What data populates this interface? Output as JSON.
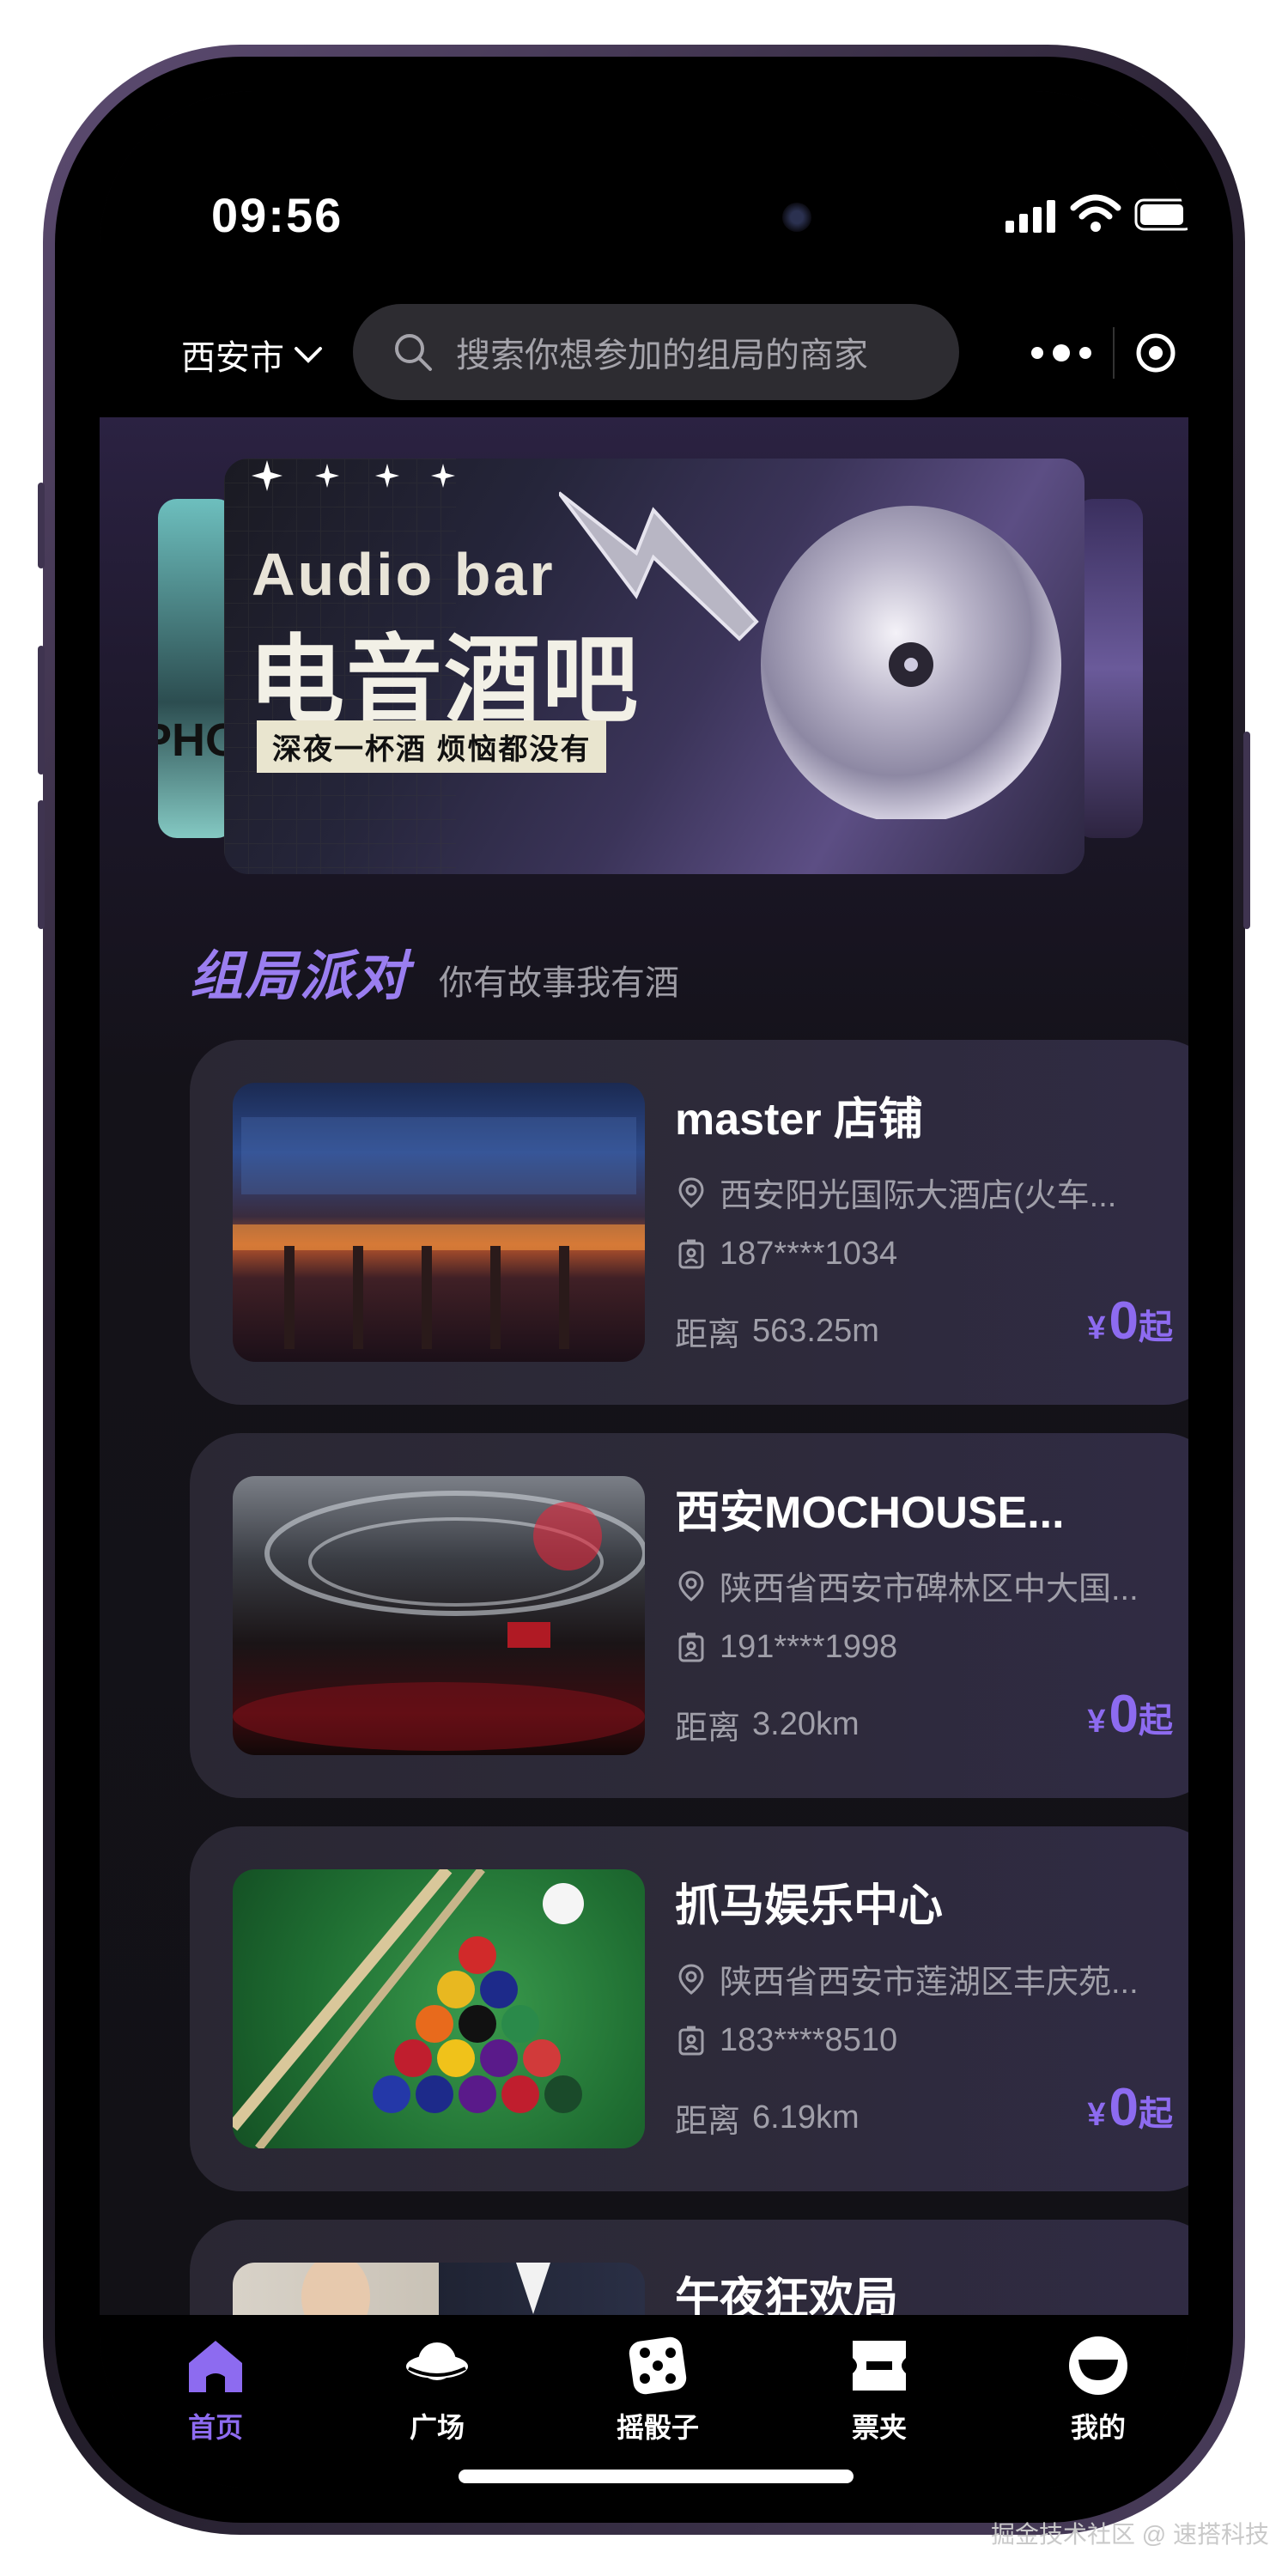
{
  "status_bar": {
    "time": "09:56"
  },
  "nav": {
    "city": "西安市",
    "search_placeholder": "搜索你想参加的组局的商家"
  },
  "banner": {
    "title_en": "Audio bar",
    "title_zh": "电音酒吧",
    "tagline": "深夜一杯酒 烦恼都没有",
    "side_text": "PHOP"
  },
  "section": {
    "title": "组局派对",
    "subtitle": "你有故事我有酒"
  },
  "venues": [
    {
      "name": "master 店铺",
      "address": "西安阳光国际大酒店(火车...",
      "phone": "187****1034",
      "distance_label": "距离",
      "distance": "563.25m",
      "currency": "¥",
      "price": "0",
      "price_suffix": "起"
    },
    {
      "name": "西安MOCHOUSE...",
      "address": "陕西省西安市碑林区中大国...",
      "phone": "191****1998",
      "distance_label": "距离",
      "distance": "3.20km",
      "currency": "¥",
      "price": "0",
      "price_suffix": "起"
    },
    {
      "name": "抓马娱乐中心",
      "address": "陕西省西安市莲湖区丰庆苑...",
      "phone": "183****8510",
      "distance_label": "距离",
      "distance": "6.19km",
      "currency": "¥",
      "price": "0",
      "price_suffix": "起"
    },
    {
      "name": "午夜狂欢局"
    }
  ],
  "tabbar": [
    {
      "label": "首页",
      "icon": "home-icon",
      "active": true
    },
    {
      "label": "广场",
      "icon": "planet-icon"
    },
    {
      "label": "摇骰子",
      "icon": "dice-icon"
    },
    {
      "label": "票夹",
      "icon": "ticket-icon"
    },
    {
      "label": "我的",
      "icon": "profile-icon"
    }
  ],
  "watermark": "掘金技术社区 @ 速搭科技",
  "colors": {
    "accent": "#8d6bf0",
    "background": "#0d0c11",
    "card": "#2b2838"
  }
}
